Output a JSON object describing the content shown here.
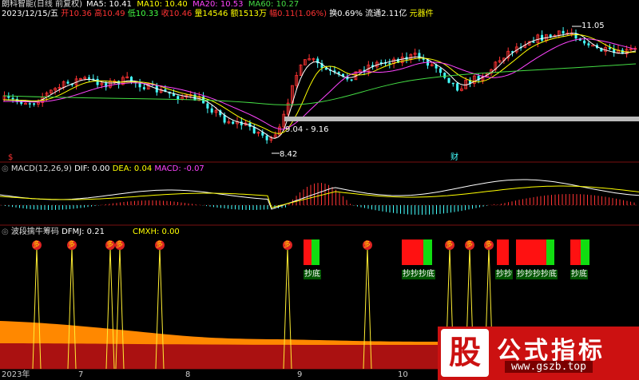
{
  "header": {
    "stock_title": "朗科智能(日线 前复权)",
    "date": "2023/12/15/五",
    "open": "开10.36",
    "high": "高10.49",
    "low": "低10.33",
    "close": "收10.46",
    "volume": "量14546",
    "amount": "额1513万",
    "change": "幅0.11(1.06%)",
    "turnover": "换0.69%",
    "float": "流通2.11亿",
    "device": "元器件"
  },
  "ma_legend": [
    {
      "label": "MA5: 10.41",
      "color": "#ffffff"
    },
    {
      "label": "MA10: 10.40",
      "color": "#ffff00"
    },
    {
      "label": "MA20: 10.53",
      "color": "#ff44ff"
    },
    {
      "label": "MA60: 10.27",
      "color": "#44dd44"
    }
  ],
  "annotations": {
    "high_mark": "11.05",
    "low_mark": "8.42",
    "range_mark": "9.04 - 9.16",
    "fin_mark": "财",
    "left_mark": "$"
  },
  "macd": {
    "title": "MACD(12,26,9)",
    "dif": "DIF: 0.00",
    "dea": "DEA: 0.04",
    "macd": "MACD: -0.07"
  },
  "indicator": {
    "title": "波段擒牛筹码",
    "dfmj": "DFMJ: 0.21",
    "cmxh": "CMXH: 0.00",
    "spike_label": "多",
    "block_labels": [
      "抄底",
      "抄抄抄底",
      "抄抄",
      "抄抄抄抄底",
      "抄底"
    ]
  },
  "xaxis": [
    "2023年",
    "7",
    "8",
    "9",
    "10"
  ],
  "watermark": {
    "logo_char": "股",
    "title": "公式指标",
    "url": "www.gszb.top"
  },
  "colors": {
    "up": "#ff3333",
    "down": "#44ffff",
    "ma5": "#ffffff",
    "ma10": "#ffff00",
    "ma20": "#ff44ff",
    "ma60": "#44dd44",
    "orange": "#ff8800",
    "darkred": "#aa1111"
  }
}
